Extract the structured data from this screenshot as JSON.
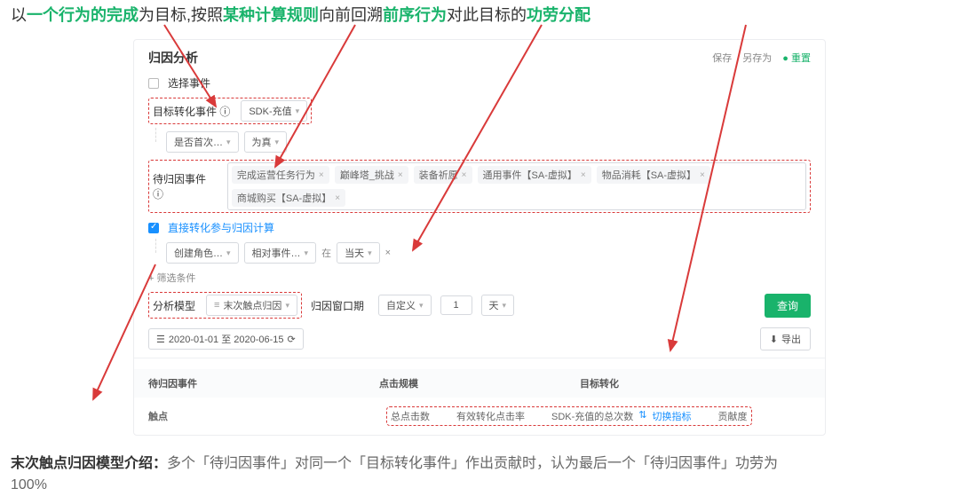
{
  "title_parts": {
    "p1": "以",
    "g1": "一个行为的完成",
    "p2": "为目标,按照",
    "g2": "某种计算规则",
    "p3": "向前回溯",
    "g3": "前序行为",
    "p4": "对此目标的",
    "g4": "功劳分配"
  },
  "header": {
    "title": "归因分析",
    "save": "保存",
    "save_as": "另存为",
    "refresh": "● 重置"
  },
  "select_event": "选择事件",
  "target": {
    "label": "目标转化事件 ⓘ",
    "value": "SDK-充值"
  },
  "filter": {
    "field": "是否首次…",
    "cond": "为真"
  },
  "candidates": {
    "label": "待归因事件 ⓘ",
    "tags": [
      "完成运营任务行为",
      "巅峰塔_挑战",
      "装备祈愿",
      "通用事件【SA-虚拟】",
      "物品消耗【SA-虚拟】",
      "商城购买【SA-虚拟】"
    ]
  },
  "direct_checkbox": "直接转化参与归因计算",
  "row3": {
    "field": "创建角色…",
    "cmp": "相对事件…",
    "at": "在",
    "day": "当天",
    "close": "×"
  },
  "add_filter": "+ 筛选条件",
  "model": {
    "label": "分析模型",
    "value": "末次触点归因"
  },
  "window": {
    "label": "归因窗口期",
    "mode": "自定义",
    "count": "1",
    "unit": "天"
  },
  "query": "查询",
  "date": {
    "range": "2020-01-01 至 2020-06-15",
    "icon": "⟳"
  },
  "export": "导出",
  "thead": {
    "c1": "待归因事件",
    "c2": "点击规模",
    "c3": "目标转化"
  },
  "trow": {
    "label": "触点",
    "m1": "总点击数",
    "m2": "有效转化点击率",
    "m3": "SDK-充值的总次数",
    "link": "切换指标",
    "m4": "贡献度"
  },
  "footer": {
    "lead": "末次触点归因模型介绍：",
    "body": "多个「待归因事件」对同一个「目标转化事件」作出贡献时，认为最后一个「待归因事件」功劳为",
    "pct": "100%"
  }
}
